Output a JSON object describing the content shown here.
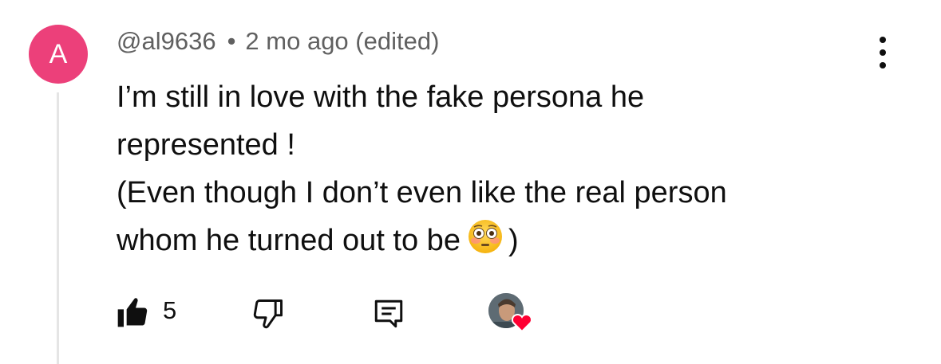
{
  "comment": {
    "avatar_initial": "A",
    "avatar_color": "#ec407a",
    "author": "@al9636",
    "separator": "•",
    "timestamp": "2 mo ago (edited)",
    "text_lines": [
      "I’m still in love with the fake persona he",
      "represented !",
      "(Even though I don’t even like the real person",
      "whom he turned out to be"
    ],
    "text_end": ")",
    "emoji": "flushed-face"
  },
  "actions": {
    "like_icon": "thumbs-up-filled-icon",
    "like_count": "5",
    "dislike_icon": "thumbs-down-icon",
    "reply_icon": "reply-comment-icon",
    "creator_heart_icon": "creator-heart-icon",
    "heart_color": "#ff0033"
  },
  "menu": {
    "icon": "more-vertical-icon"
  }
}
